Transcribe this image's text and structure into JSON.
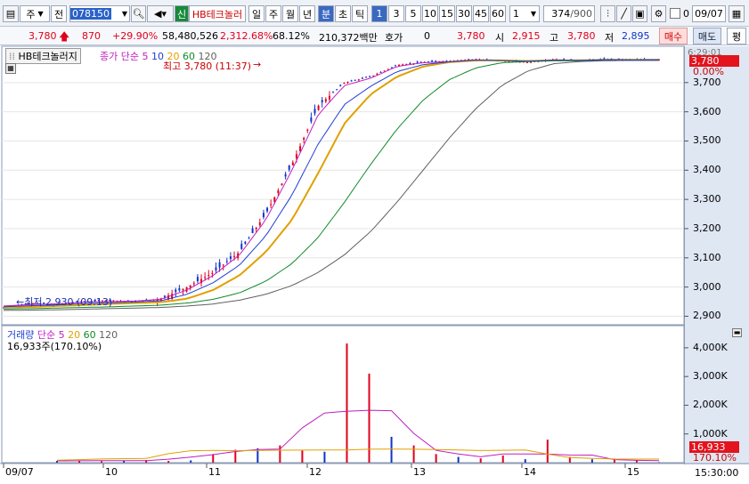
{
  "toolbar": {
    "market": "주",
    "period_btn": "전",
    "code": "078150",
    "credit_badge": "신",
    "stock_name": "HB테크놀러",
    "periods": [
      "일",
      "주",
      "월",
      "년",
      "분",
      "초",
      "틱"
    ],
    "active_period": "분",
    "intervals": [
      "1",
      "3",
      "5",
      "10",
      "15",
      "30",
      "45",
      "60"
    ],
    "active_interval": "1",
    "interval_select": "1",
    "count": "374",
    "count_max": "/900",
    "checkbox_label": "0",
    "date": "09/07"
  },
  "quote": {
    "price": "3,780",
    "change": "870",
    "change_pct": "+29.90%",
    "volume": "58,480,526",
    "volume_pct": "2,312.68%",
    "turnover": "68.12%",
    "amount": "210,372백만",
    "hoga_label": "호가",
    "hoga_value": "0",
    "hoga_price": "3,780",
    "open_label": "시",
    "open": "2,915",
    "high_label": "고",
    "high": "3,780",
    "low_label": "저",
    "low": "2,895",
    "buy_btn": "매수",
    "sell_btn": "매도",
    "eval_btn": "평"
  },
  "price_panel": {
    "name": "HB테크놀러지",
    "ma_label": "종가 단순",
    "ma_periods": [
      "5",
      "10",
      "20",
      "60",
      "120"
    ],
    "ma_colors": [
      "#c01ec0",
      "#1f3fd0",
      "#e0a000",
      "#0f8a2a",
      "#606060"
    ],
    "high_note": "최고 3,780 (11:37)",
    "low_note": "최저 2,930 (09:13)",
    "time_tag": "6:29:01",
    "price_tag": "3,780",
    "pct_tag": "0.00%"
  },
  "volume_panel": {
    "name": "거래량",
    "ma_label": "단순",
    "ma_periods": [
      "5",
      "20",
      "60",
      "120"
    ],
    "current": "16,933주(170.10%)",
    "vol_tag": "16,933",
    "pct_tag": "170.10%"
  },
  "chart_data": [
    {
      "type": "line",
      "title": "HB테크놀러지 1분봉",
      "y_ticks": [
        "3,700",
        "3,600",
        "3,500",
        "3,400",
        "3,300",
        "3,200",
        "3,100",
        "3,000",
        "2,900"
      ],
      "ylim": [
        2880,
        3800
      ],
      "x_ticks": [
        "09/07",
        "10",
        "11",
        "12",
        "13",
        "14",
        "15"
      ],
      "series": [
        {
          "name": "종가",
          "values": [
            2930,
            2945,
            2940,
            2950,
            2955,
            2950,
            2960,
            3000,
            3050,
            3120,
            3250,
            3420,
            3620,
            3700,
            3720,
            3760,
            3770,
            3775,
            3780,
            3775,
            3770,
            3780,
            3775,
            3780,
            3778,
            3780
          ]
        }
      ],
      "ma": {
        "5": [
          2935,
          2940,
          2942,
          2948,
          2950,
          2952,
          2958,
          2990,
          3040,
          3110,
          3230,
          3400,
          3590,
          3690,
          3715,
          3755,
          3768,
          3772,
          3778,
          3775,
          3772,
          3778,
          3776,
          3779,
          3778,
          3779
        ],
        "20": [
          2930,
          2932,
          2935,
          2938,
          2942,
          2945,
          2948,
          2960,
          2990,
          3040,
          3120,
          3230,
          3390,
          3560,
          3660,
          3720,
          3755,
          3770,
          3776,
          3776,
          3774,
          3776,
          3776,
          3778,
          3778,
          3778
        ],
        "60": [
          2925,
          2926,
          2928,
          2930,
          2932,
          2935,
          2938,
          2945,
          2958,
          2980,
          3020,
          3080,
          3170,
          3290,
          3420,
          3540,
          3640,
          3710,
          3750,
          3768,
          3772,
          3775,
          3775,
          3776,
          3776,
          3777
        ],
        "120": [
          2920,
          2921,
          2922,
          2924,
          2926,
          2928,
          2930,
          2935,
          2942,
          2955,
          2975,
          3005,
          3050,
          3110,
          3190,
          3290,
          3400,
          3510,
          3610,
          3690,
          3740,
          3765,
          3772,
          3775,
          3776,
          3776
        ]
      }
    },
    {
      "type": "bar",
      "title": "거래량",
      "y_ticks": [
        "4,000K",
        "3,000K",
        "2,000K",
        "1,000K"
      ],
      "ylim": [
        0,
        4400000
      ],
      "values": [
        60000,
        80000,
        50000,
        70000,
        90000,
        60000,
        80000,
        300000,
        450000,
        500000,
        600000,
        420000,
        380000,
        4150000,
        3100000,
        900000,
        600000,
        300000,
        200000,
        150000,
        250000,
        120000,
        800000,
        200000,
        120000,
        100000,
        90000,
        16933
      ]
    }
  ],
  "footer": {
    "time": "15:30:00"
  }
}
